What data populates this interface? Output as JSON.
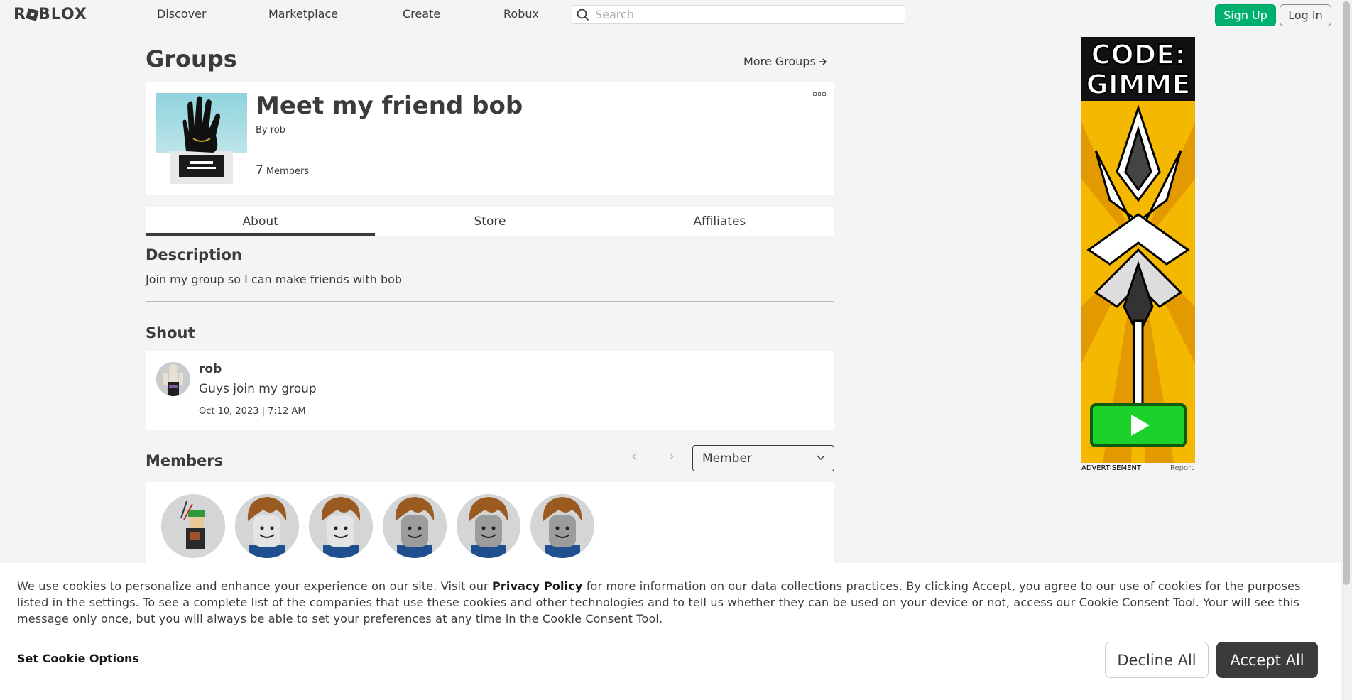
{
  "nav": {
    "logo": "ROBLOX",
    "links": [
      "Discover",
      "Marketplace",
      "Create",
      "Robux"
    ],
    "search_placeholder": "Search",
    "signup": "Sign Up",
    "login": "Log In"
  },
  "page": {
    "title": "Groups",
    "more_groups": "More Groups"
  },
  "group": {
    "name": "Meet my friend bob",
    "by": "By rob",
    "member_count": "7",
    "members_label": "Members"
  },
  "tabs": [
    "About",
    "Store",
    "Affiliates"
  ],
  "description": {
    "title": "Description",
    "text": "Join my group so I can make friends with bob"
  },
  "shout": {
    "title": "Shout",
    "user": "rob",
    "text": "Guys join my group",
    "date": "Oct 10, 2023 | 7:12 AM"
  },
  "members": {
    "title": "Members",
    "role_filter": "Member",
    "count_shown": 6
  },
  "ad": {
    "headline_1": "CODE:",
    "headline_2": "GIMME",
    "label": "ADVERTISEMENT",
    "report": "Report"
  },
  "cookie": {
    "text_before": "We use cookies to personalize and enhance your experience on our site. Visit our ",
    "privacy_link": "Privacy Policy",
    "text_after": " for more information on our data collections practices. By clicking Accept, you agree to our use of cookies for the purposes listed in the settings. To see a complete list of the companies that use these cookies and other technologies and to tell us whether they can be used on your device or not, access our Cookie Consent Tool. Your will see this message only once, but you will always be able to set your preferences at any time in the Cookie Consent Tool.",
    "set_options": "Set Cookie Options",
    "decline": "Decline All",
    "accept": "Accept All"
  }
}
